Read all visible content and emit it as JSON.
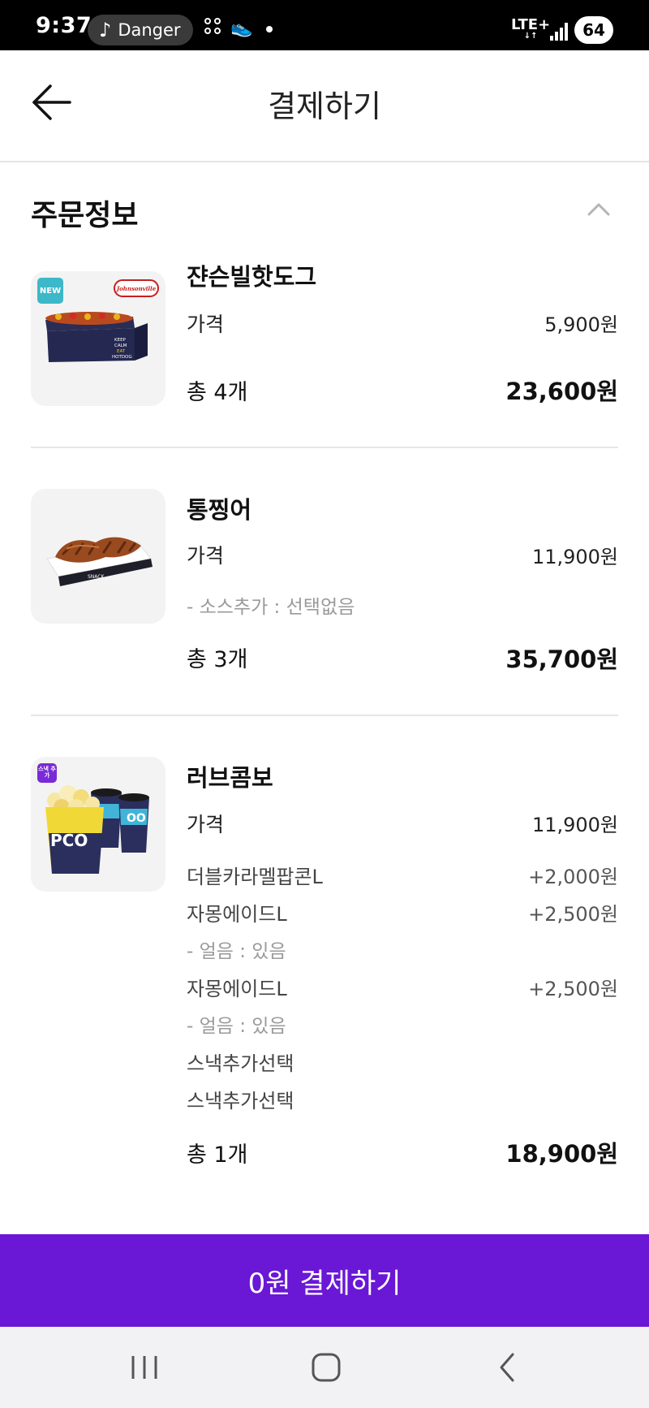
{
  "status_bar": {
    "time": "9:37",
    "media_title": "Danger",
    "network": "LTE+",
    "battery": "64"
  },
  "header": {
    "title": "결제하기"
  },
  "section": {
    "title": "주문정보"
  },
  "items": [
    {
      "name": "쟌슨빌핫도그",
      "badge": "NEW",
      "brand": "Johnsonville",
      "price_label": "가격",
      "price": "5,900원",
      "total_label": "총 4개",
      "total": "23,600원"
    },
    {
      "name": "통찡어",
      "price_label": "가격",
      "price": "11,900원",
      "option": "- 소스추가 : 선택없음",
      "total_label": "총 3개",
      "total": "35,700원"
    },
    {
      "name": "러브콤보",
      "badge": "스낵 추가",
      "price_label": "가격",
      "price": "11,900원",
      "options": [
        {
          "label": "더블카라멜팝콘L",
          "value": "+2,000원"
        },
        {
          "label": "자몽에이드L",
          "value": "+2,500원"
        },
        {
          "label": "- 얼음 : 있음",
          "value": ""
        },
        {
          "label": "자몽에이드L",
          "value": "+2,500원"
        },
        {
          "label": "- 얼음 : 있음",
          "value": ""
        },
        {
          "label": "스낵추가선택",
          "value": ""
        },
        {
          "label": "스낵추가선택",
          "value": ""
        }
      ],
      "total_label": "총 1개",
      "total": "18,900원"
    }
  ],
  "pay_button": {
    "label": "0원 결제하기"
  },
  "colors": {
    "accent": "#6a17d6",
    "new_badge": "#3cb8c8",
    "snack_badge": "#7a2ad6"
  },
  "icons": [
    "back-arrow-icon",
    "chevron-up-icon",
    "recent-apps-icon",
    "home-icon",
    "back-icon"
  ]
}
